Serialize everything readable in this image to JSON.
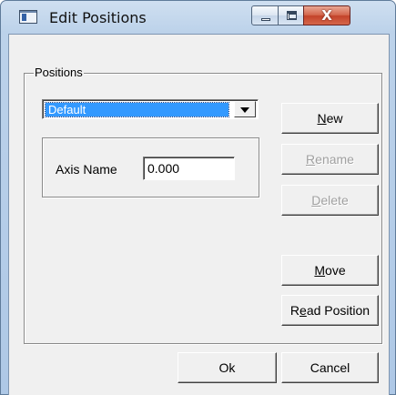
{
  "window": {
    "title": "Edit Positions",
    "icon": "app-window-icon",
    "controls": {
      "minimize": "minimize-icon",
      "maximize": "maximize-icon",
      "close": "close-icon",
      "close_glyph": "X"
    }
  },
  "positions": {
    "legend": "Positions",
    "selected": "Default",
    "axis_label": "Axis Name",
    "axis_value": "0.000"
  },
  "buttons": {
    "new": {
      "prefix": "",
      "mnemonic": "N",
      "rest": "ew",
      "enabled": true
    },
    "rename": {
      "prefix": "",
      "mnemonic": "R",
      "rest": "ename",
      "enabled": false
    },
    "delete": {
      "prefix": "",
      "mnemonic": "D",
      "rest": "elete",
      "enabled": false
    },
    "move": {
      "prefix": "",
      "mnemonic": "M",
      "rest": "ove",
      "enabled": true
    },
    "read_position": {
      "prefix": "R",
      "mnemonic": "e",
      "rest": "ad Position",
      "enabled": true
    },
    "ok": "Ok",
    "cancel": "Cancel"
  },
  "colors": {
    "selection": "#3399ff",
    "dialog_face": "#f0f0f0",
    "close_button": "#c3432a"
  }
}
